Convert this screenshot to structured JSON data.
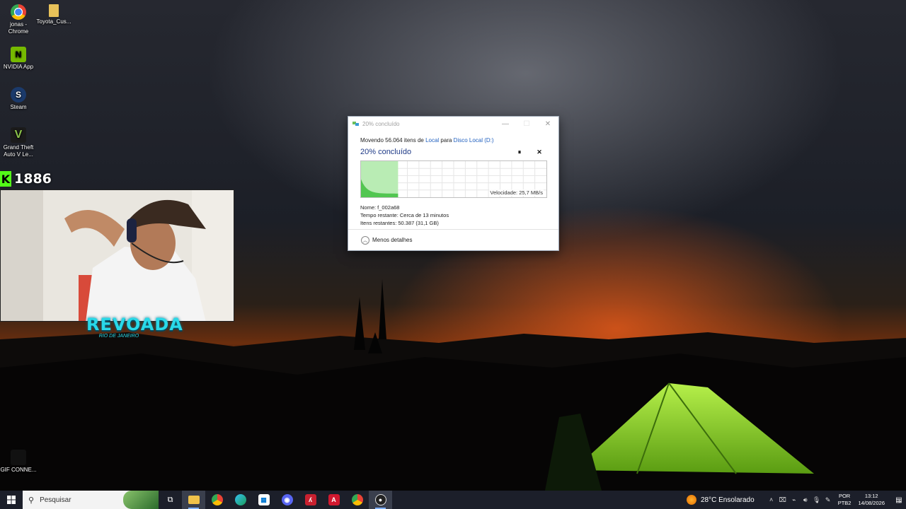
{
  "desktop": {
    "icons": [
      {
        "label": "jonas - Chrome",
        "icon": "chrome-icon"
      },
      {
        "label": "Toyota_Cus...",
        "icon": "folder-icon"
      },
      {
        "label": "NVIDIA App",
        "icon": "nvidia-icon"
      },
      {
        "label": "Steam",
        "icon": "steam-icon"
      },
      {
        "label": "Grand Theft Auto V Le...",
        "icon": "gta-icon"
      },
      {
        "label": "GIF CONNE...",
        "icon": "gif-icon"
      }
    ]
  },
  "overlay": {
    "kick_count": "1886",
    "logo_main": "REVOADA",
    "logo_sub": "RIO DE JANEIRO"
  },
  "dialog": {
    "title": "20% concluído",
    "moving_prefix": "Movendo 56.064 itens de ",
    "source": "Local",
    "moving_mid": " para ",
    "destination": "Disco Local (D:)",
    "status": "20% concluído",
    "progress_percent": 20,
    "speed": "Velocidade: 25,7 MB/s",
    "name": "Nome: f_002a68",
    "time_remaining": "Tempo restante: Cerca de 13 minutos",
    "items_remaining": "Itens restantes: 50.387 (31,1 GB)",
    "less_details": "Menos detalhes",
    "pause_glyph": "⏸",
    "cancel_glyph": "✕",
    "minimize_glyph": "—",
    "maximize_glyph": "☐",
    "close_glyph": "✕"
  },
  "taskbar": {
    "search_placeholder": "Pesquisar",
    "apps": [
      "task-view",
      "file-explorer",
      "chrome",
      "edge",
      "store",
      "discord",
      "app-red",
      "app-a",
      "chrome-2",
      "obs"
    ],
    "weather": "28°C  Ensolarado",
    "lang_line1": "POR",
    "lang_line2": "PTB2",
    "time": "13:12",
    "date": "14/08/2026",
    "notification_count": "5"
  },
  "colors": {
    "progress_fill": "#9be39b",
    "progress_line": "#1f8f1f",
    "taskbar": "#1c1f2a",
    "accent": "#1f5fbf"
  }
}
